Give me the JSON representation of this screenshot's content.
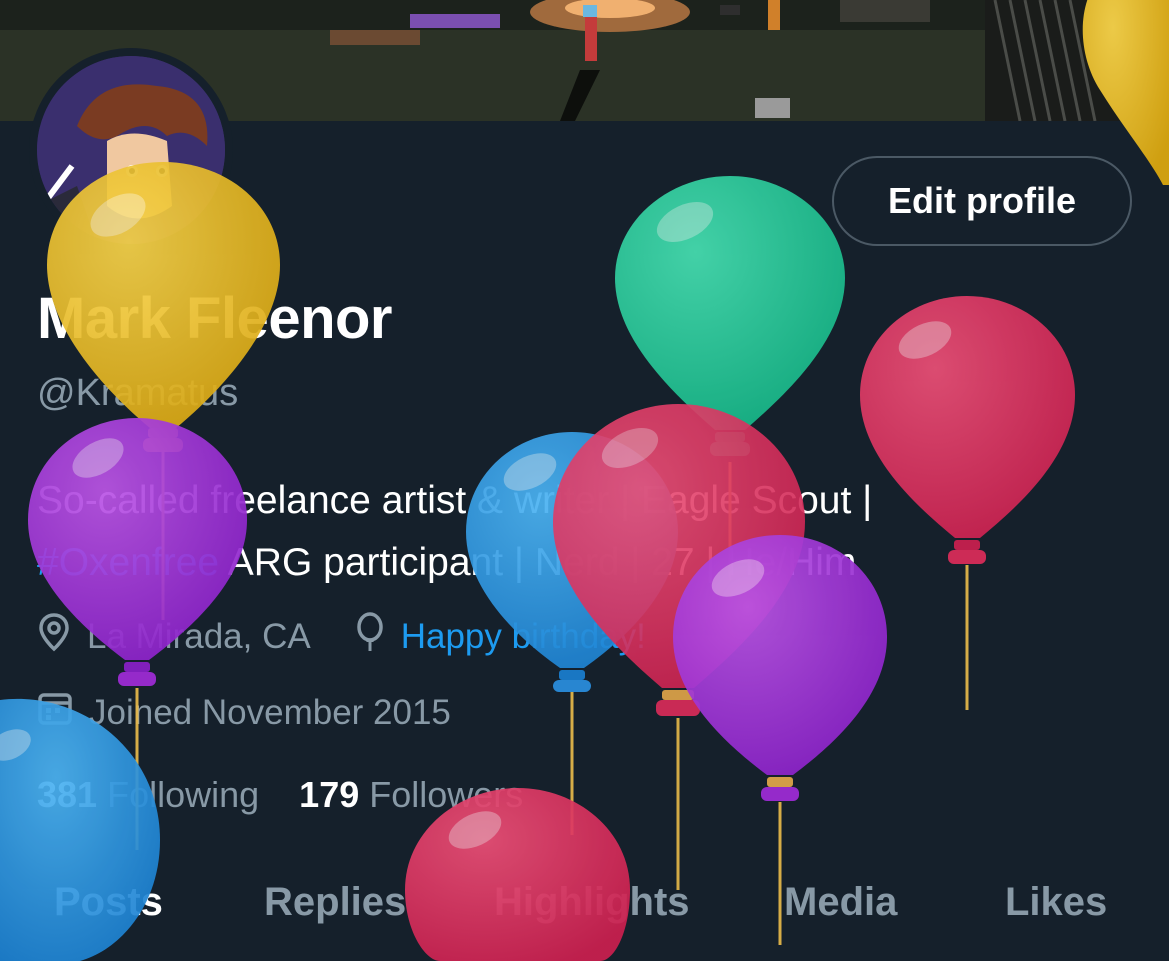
{
  "profile": {
    "name": "Mark Fleenor",
    "handle": "@Kramatus",
    "bio": {
      "part1": "So-called freelance artist & writer | Eagle Scout |",
      "hashtag": "#Oxenfree",
      "part2": " ARG participant | Nerd | 27 | He/Him"
    },
    "location": "La Mirada, CA",
    "birthday_link": "Happy birthday!",
    "joined": "Joined November 2015",
    "following_count": "381",
    "following_label": " Following",
    "followers_count": "179",
    "followers_label": " Followers"
  },
  "buttons": {
    "edit_profile": "Edit profile"
  },
  "tabs": [
    {
      "label": "Posts",
      "active": true
    },
    {
      "label": "Replies",
      "active": false
    },
    {
      "label": "Highlights",
      "active": false
    },
    {
      "label": "Media",
      "active": false
    },
    {
      "label": "Likes",
      "active": false
    }
  ],
  "icons": {
    "location": "location-pin-icon",
    "birthday": "balloon-icon",
    "joined": "calendar-icon"
  },
  "colors": {
    "background": "#15202b",
    "accent": "#1d9bf0",
    "muted": "#8899a6",
    "balloon_yellow": "#f2c12e",
    "balloon_green": "#2bd4a0",
    "balloon_red": "#e0245e",
    "balloon_purple": "#a33ad9",
    "balloon_blue": "#2b9ae6"
  }
}
